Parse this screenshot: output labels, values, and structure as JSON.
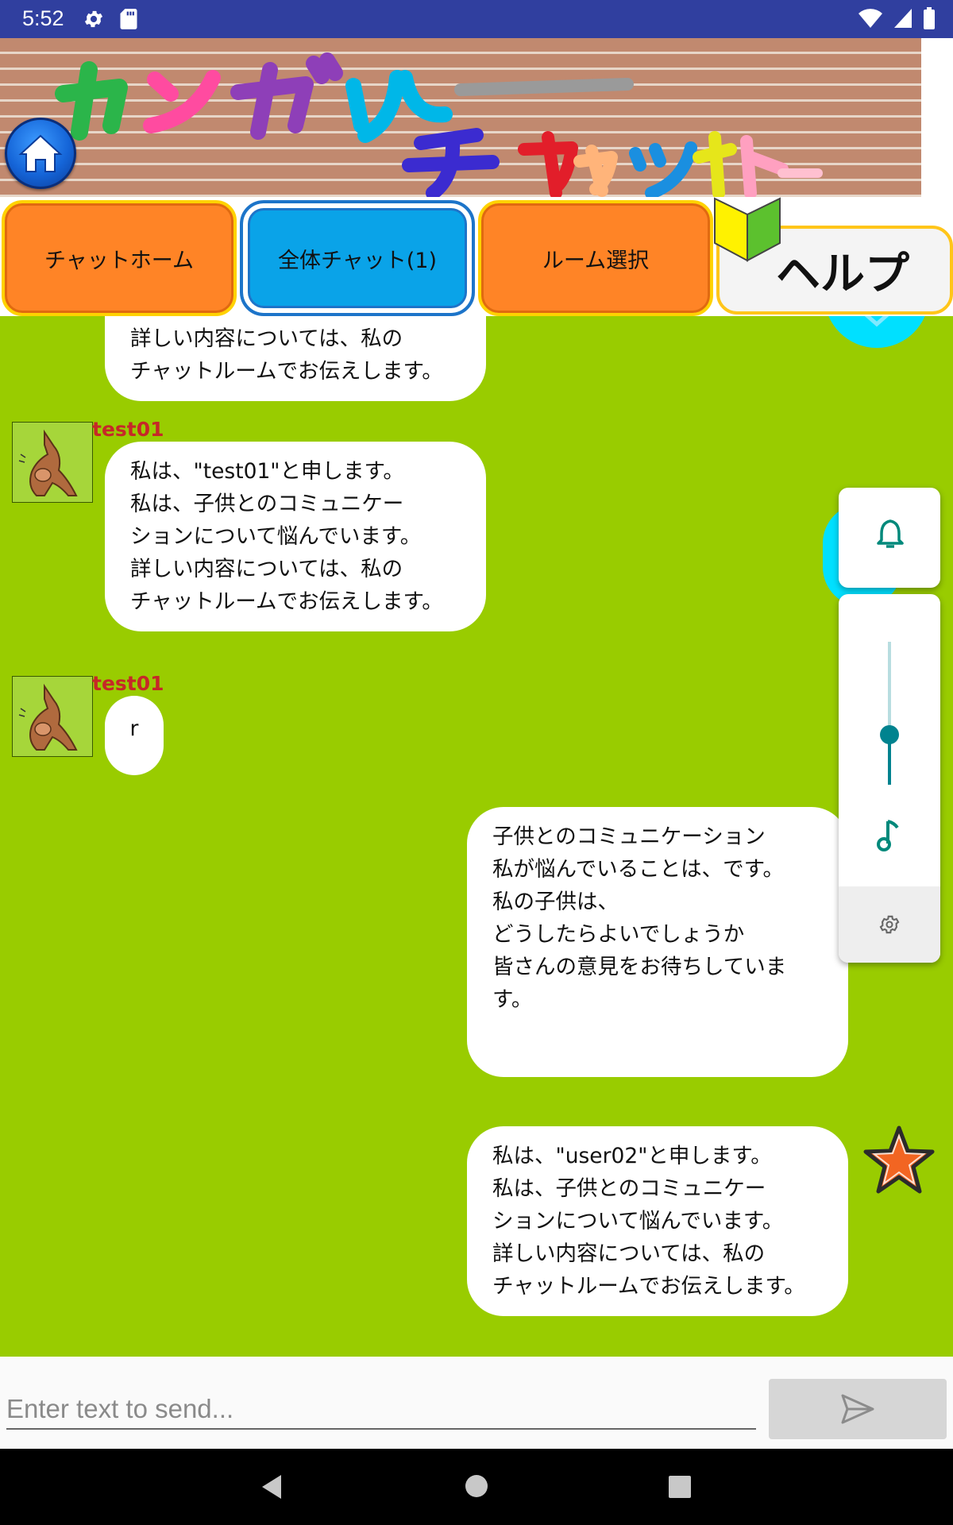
{
  "status_bar": {
    "time": "5:52",
    "left_icons": [
      "settings-icon",
      "sd-card-icon"
    ],
    "right_icons": [
      "wifi-icon",
      "signal-icon",
      "battery-icon"
    ]
  },
  "header": {
    "title": "カンガルーチャット",
    "title_line1": "カンガルー",
    "title_line2": "チャット"
  },
  "tabs": [
    {
      "label": "チャットホーム"
    },
    {
      "label": "全体チャット(1)"
    },
    {
      "label": "ルーム選択"
    },
    {
      "label": "ヘルプ"
    }
  ],
  "messages": [
    {
      "side": "left",
      "user": "",
      "text": "詳しい内容については、私の\nチャットルームでお伝えします。"
    },
    {
      "side": "left",
      "user": "test01",
      "text": "私は、\"test01\"と申します。\n私は、子供とのコミュニケー\nションについて悩んでいます。\n詳しい内容については、私の\nチャットルームでお伝えします。"
    },
    {
      "side": "left",
      "user": "test01",
      "text": "r"
    },
    {
      "side": "right",
      "user": "",
      "text": "子供とのコミュニケーション\n私が悩んでいることは、です。\n私の子供は、\nどうしたらよいでしょうか\n皆さんの意見をお待ちしていま\nす。"
    },
    {
      "side": "right",
      "user": "",
      "text": "私は、\"user02\"と申します。\n私は、子供とのコミュニケー\nションについて悩んでいます。\n詳しい内容については、私の\nチャットルームでお伝えします。"
    }
  ],
  "volume_panel": {
    "icons": [
      "bell-icon",
      "music-note-icon",
      "gear-icon"
    ],
    "level": 0.35
  },
  "input": {
    "placeholder": "Enter text to send..."
  },
  "colors": {
    "status_bar": "#303F9F",
    "chat_background": "#99CC00",
    "tab_orange": "#FF8426",
    "tab_blue": "#0AA3E8",
    "username": "#C62828",
    "accent": "#00838F"
  }
}
